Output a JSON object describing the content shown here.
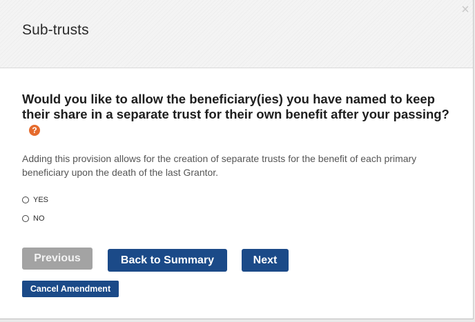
{
  "modal": {
    "title": "Sub-trusts",
    "close_glyph": "×"
  },
  "question": {
    "text": "Would you like to allow the beneficiary(ies) you have named to keep their share in a separate trust for their own benefit after your passing?",
    "help_glyph": "?"
  },
  "description": "Adding this provision allows for the creation of separate trusts for the benefit of each primary beneficiary upon the death of the last Grantor.",
  "options": {
    "yes_label": "YES",
    "no_label": "NO"
  },
  "buttons": {
    "previous": "Previous",
    "back_to_summary": "Back to Summary",
    "next": "Next",
    "cancel_amendment": "Cancel Amendment"
  },
  "colors": {
    "primary_button": "#1b4a88",
    "disabled_button": "#a3a3a3",
    "help_icon": "#e56b2d"
  },
  "icons": {
    "close": "close-icon",
    "help": "question-mark-icon"
  }
}
